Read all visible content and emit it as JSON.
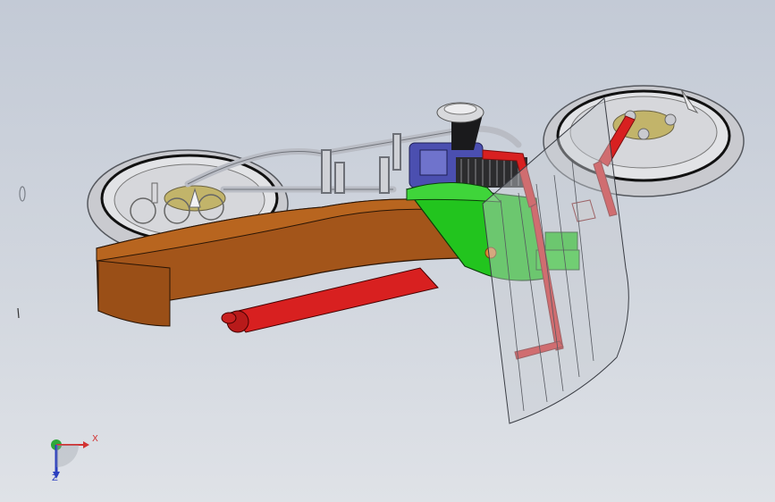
{
  "viewport": {
    "background_top": "#c3cad6",
    "background_bottom": "#dfe2e7"
  },
  "model": {
    "colors": {
      "body_shell": "#a3551a",
      "body_shell_top": "#b8651f",
      "seat_frame": "#22c41e",
      "frame_red": "#d82020",
      "engine_blue": "#4b4fb0",
      "tire": "#c9cacf",
      "rim_gold": "#c2b46a",
      "windshield": "#c7ccd3",
      "tube_gray": "#b9bcc4"
    },
    "icons": [
      "front-wheel",
      "rear-wheel",
      "engine",
      "muffler",
      "windshield",
      "handlebar",
      "frame"
    ]
  },
  "triad": {
    "x_label": "X",
    "z_label": "Z",
    "x_color": "#d23333",
    "y_color": "#2fa83a",
    "z_color": "#2b3fbf"
  }
}
